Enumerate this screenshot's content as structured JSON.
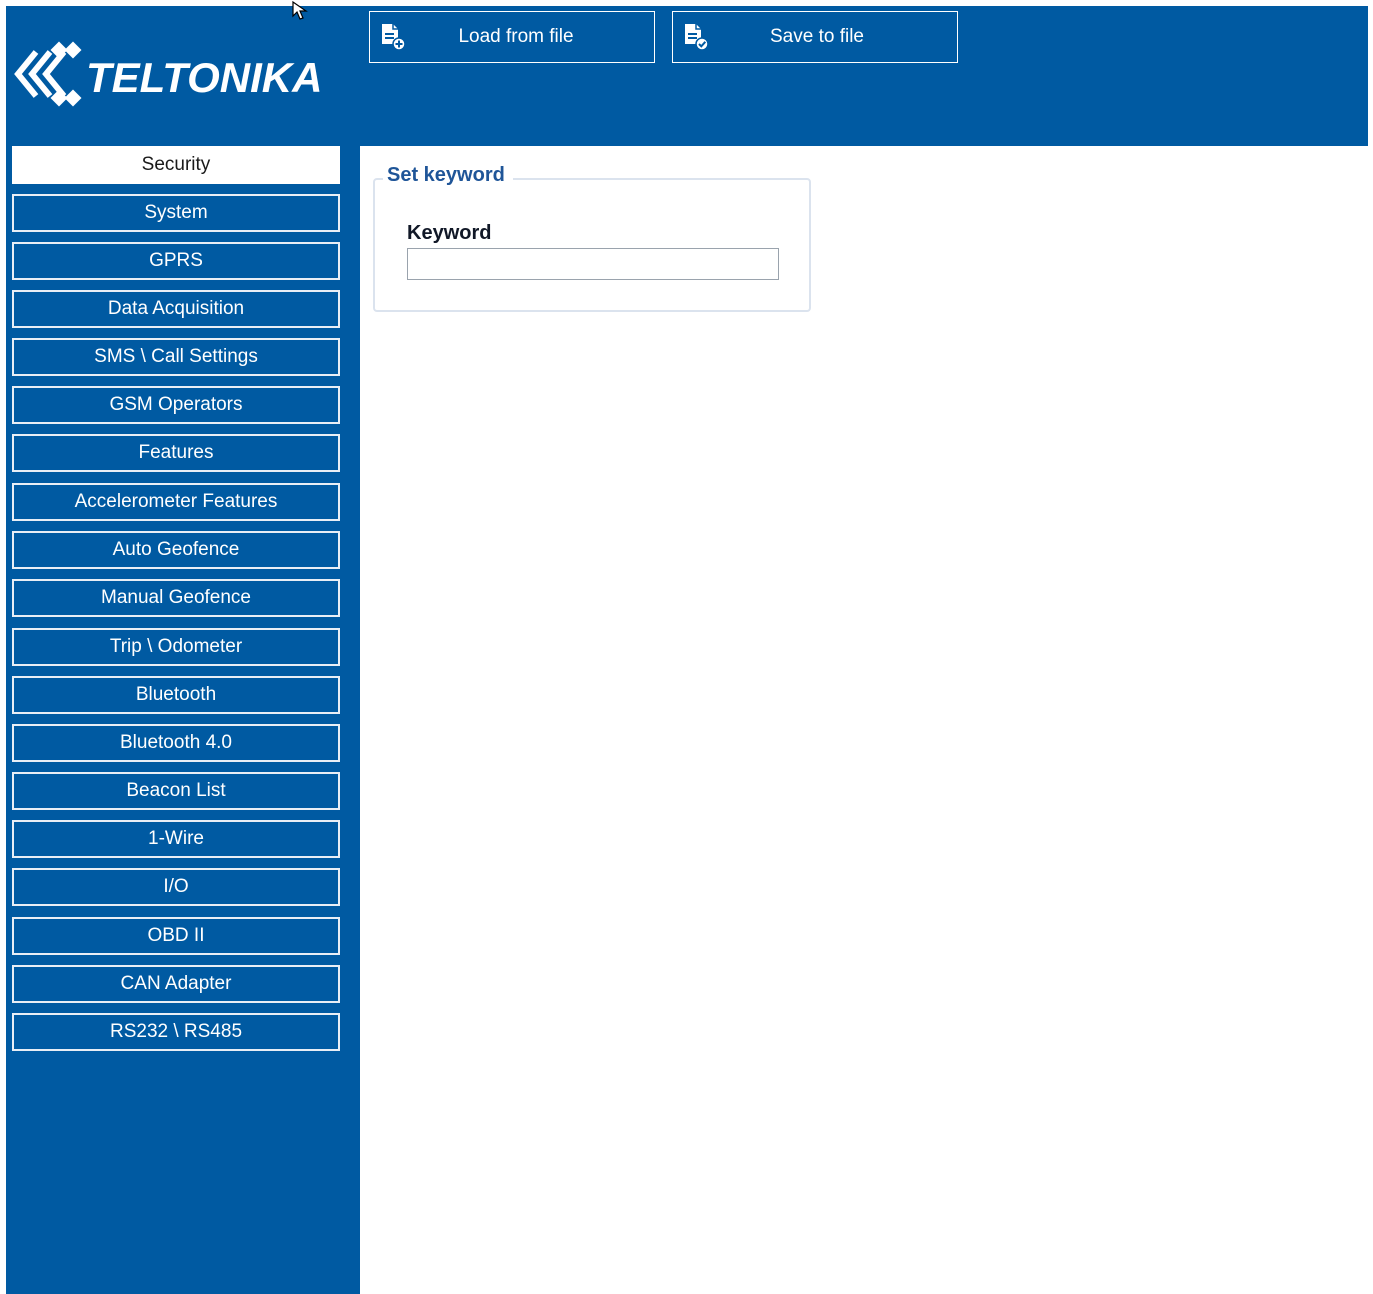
{
  "brand": {
    "logo_text": "TELTONIKA",
    "primary_color": "#005aa2"
  },
  "toolbar": {
    "load_label": "Load from file",
    "save_label": "Save to file",
    "load_icon": "file-add-icon",
    "save_icon": "file-check-icon"
  },
  "sidebar": {
    "items": [
      {
        "label": "Security",
        "active": true
      },
      {
        "label": "System"
      },
      {
        "label": "GPRS"
      },
      {
        "label": "Data Acquisition"
      },
      {
        "label": "SMS \\ Call Settings"
      },
      {
        "label": "GSM Operators"
      },
      {
        "label": "Features"
      },
      {
        "label": "Accelerometer Features"
      },
      {
        "label": "Auto Geofence"
      },
      {
        "label": "Manual Geofence"
      },
      {
        "label": "Trip \\ Odometer"
      },
      {
        "label": "Bluetooth"
      },
      {
        "label": "Bluetooth 4.0"
      },
      {
        "label": "Beacon List"
      },
      {
        "label": "1-Wire"
      },
      {
        "label": "I/O"
      },
      {
        "label": "OBD II"
      },
      {
        "label": "CAN Adapter"
      },
      {
        "label": "RS232 \\ RS485"
      }
    ]
  },
  "main": {
    "group_title": "Set keyword",
    "keyword": {
      "label": "Keyword",
      "value": ""
    }
  }
}
